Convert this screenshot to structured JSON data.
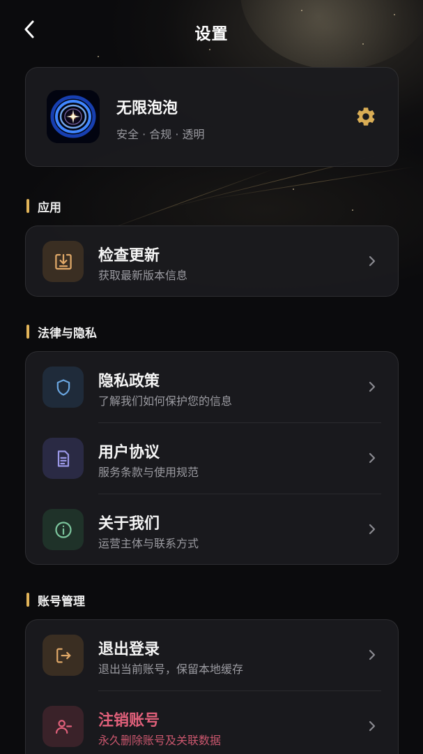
{
  "header": {
    "title": "设置"
  },
  "profile": {
    "name": "无限泡泡",
    "tagline": "安全 · 合规 · 透明"
  },
  "sections": [
    {
      "label": "应用",
      "items": [
        {
          "title": "检查更新",
          "subtitle": "获取最新版本信息",
          "icon": "download-icon"
        }
      ]
    },
    {
      "label": "法律与隐私",
      "items": [
        {
          "title": "隐私政策",
          "subtitle": "了解我们如何保护您的信息",
          "icon": "shield-icon"
        },
        {
          "title": "用户协议",
          "subtitle": "服务条款与使用规范",
          "icon": "document-icon"
        },
        {
          "title": "关于我们",
          "subtitle": "运营主体与联系方式",
          "icon": "info-icon"
        }
      ]
    },
    {
      "label": "账号管理",
      "items": [
        {
          "title": "退出登录",
          "subtitle": "退出当前账号，保留本地缓存",
          "icon": "logout-icon"
        },
        {
          "title": "注销账号",
          "subtitle": "永久删除账号及关联数据",
          "icon": "remove-user-icon"
        }
      ]
    }
  ],
  "colors": {
    "accent": "#e2b459",
    "danger": "#e0607a",
    "background": "#0b0b0d",
    "card": "#1b1b1e"
  }
}
